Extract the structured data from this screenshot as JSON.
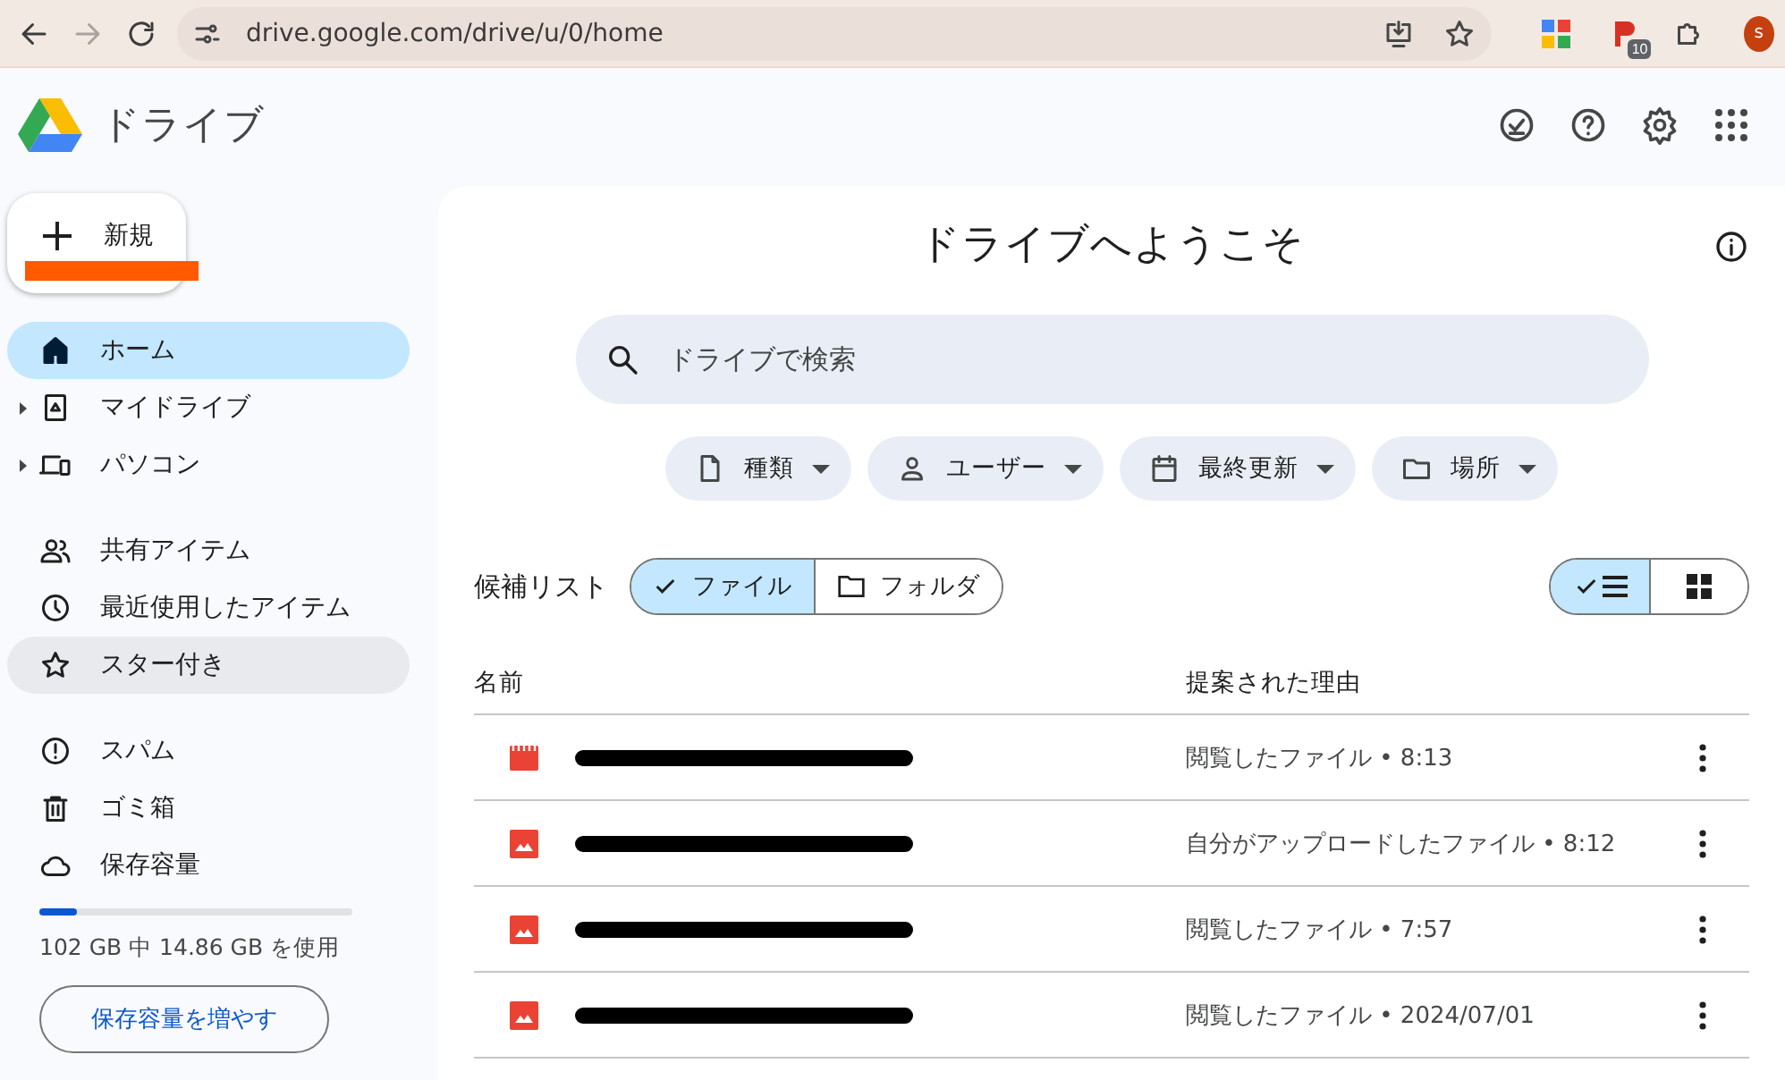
{
  "browser": {
    "url": "drive.google.com/drive/u/0/home",
    "extension_badge": "10",
    "profile_initial": "s"
  },
  "app": {
    "title": "ドライブ"
  },
  "sidebar": {
    "new_button": "新規",
    "sections": [
      [
        {
          "label": "ホーム",
          "kind": "home",
          "selected": true,
          "expandable": false,
          "hovered": false
        },
        {
          "label": "マイドライブ",
          "kind": "drive",
          "selected": false,
          "expandable": true,
          "hovered": false
        },
        {
          "label": "パソコン",
          "kind": "computer",
          "selected": false,
          "expandable": true,
          "hovered": false
        }
      ],
      [
        {
          "label": "共有アイテム",
          "kind": "shared",
          "selected": false,
          "expandable": false,
          "hovered": false
        },
        {
          "label": "最近使用したアイテム",
          "kind": "recent",
          "selected": false,
          "expandable": false,
          "hovered": false
        },
        {
          "label": "スター付き",
          "kind": "starred",
          "selected": false,
          "expandable": false,
          "hovered": true
        }
      ],
      [
        {
          "label": "スパム",
          "kind": "spam",
          "selected": false,
          "expandable": false,
          "hovered": false
        },
        {
          "label": "ゴミ箱",
          "kind": "trash",
          "selected": false,
          "expandable": false,
          "hovered": false
        },
        {
          "label": "保存容量",
          "kind": "storage",
          "selected": false,
          "expandable": false,
          "hovered": false
        }
      ]
    ],
    "storage": {
      "level": 0.12,
      "text": "102 GB 中 14.86 GB を使用",
      "button": "保存容量を増やす"
    }
  },
  "main": {
    "heading": "ドライブへようこそ",
    "search": {
      "placeholder": "ドライブで検索"
    },
    "filters": [
      {
        "label": "種類",
        "kind": "type"
      },
      {
        "label": "ユーザー",
        "kind": "people"
      },
      {
        "label": "最終更新",
        "kind": "modified"
      },
      {
        "label": "場所",
        "kind": "location"
      }
    ],
    "suggestions_label": "候補リスト",
    "segments": [
      {
        "label": "ファイル",
        "selected": true
      },
      {
        "label": "フォルダ",
        "selected": false
      }
    ],
    "view_toggle": [
      {
        "kind": "list",
        "selected": true
      },
      {
        "kind": "grid",
        "selected": false
      }
    ],
    "columns": [
      "名前",
      "提案された理由"
    ],
    "rows": [
      {
        "kind": "video",
        "reason": "閲覧したファイル • 8:13"
      },
      {
        "kind": "image",
        "reason": "自分がアップロードしたファイル • 8:12"
      },
      {
        "kind": "image",
        "reason": "閲覧したファイル • 7:57"
      },
      {
        "kind": "image",
        "reason": "閲覧したファイル • 2024/07/01"
      }
    ]
  }
}
